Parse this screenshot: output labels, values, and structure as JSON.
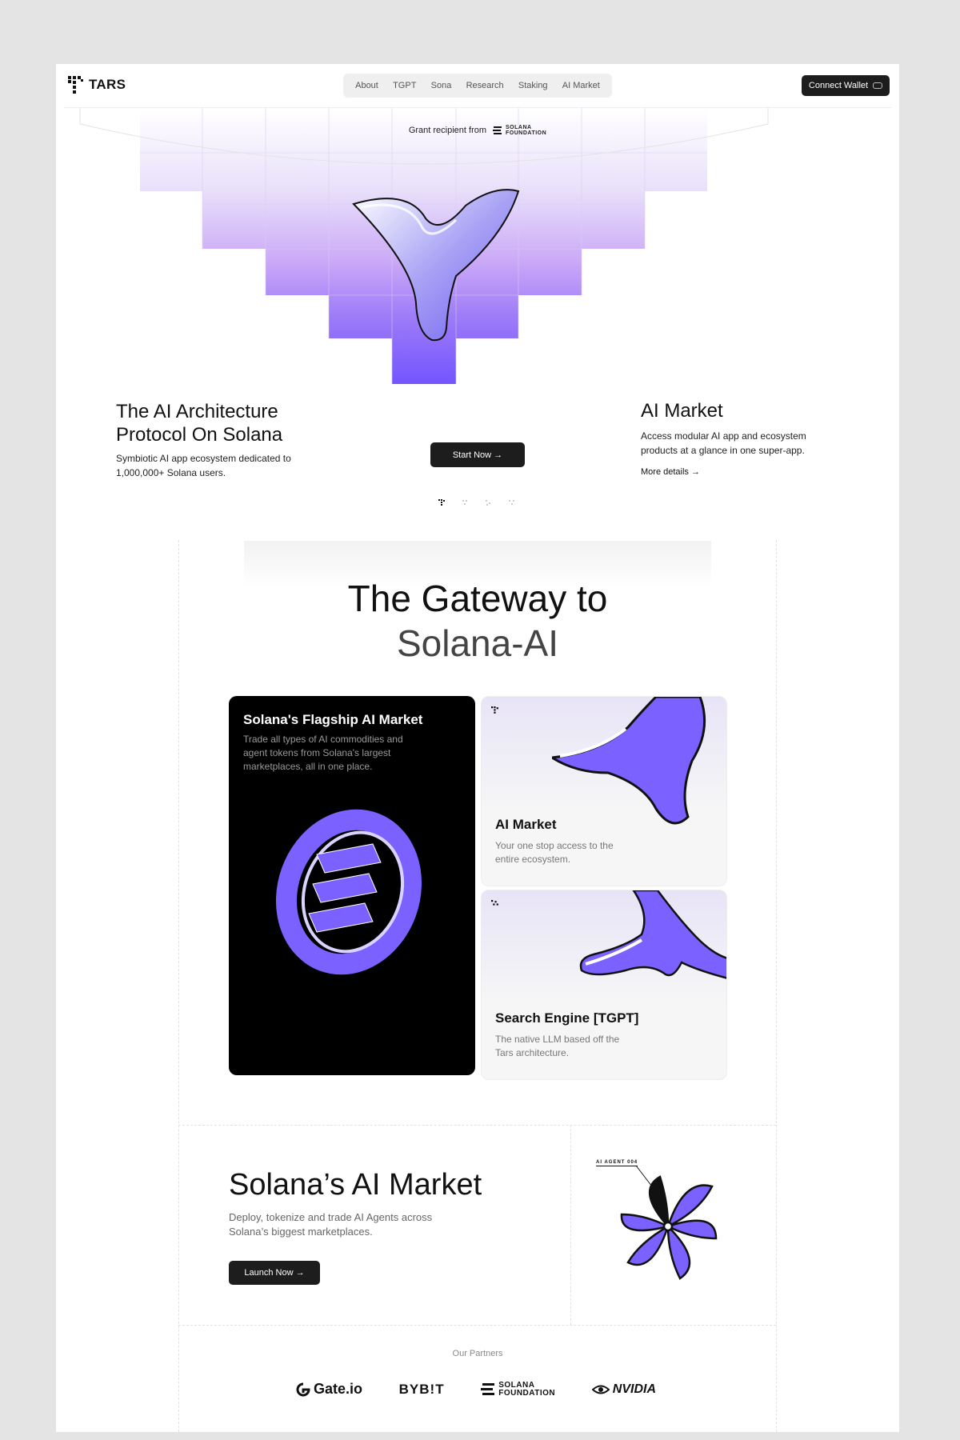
{
  "header": {
    "logo_text": "TARS",
    "nav": [
      "About",
      "TGPT",
      "Sona",
      "Research",
      "Staking",
      "AI Market"
    ],
    "connect_label": "Connect Wallet"
  },
  "hero": {
    "grant_text": "Grant recipient from",
    "grant_org_line1": "SOLANA",
    "grant_org_line2": "FOUNDATION",
    "title_line1": "The AI Architecture",
    "title_line2": "Protocol On Solana",
    "subtitle": "Symbiotic AI app ecosystem dedicated to 1,000,000+ Solana users.",
    "start_button": "Start Now →",
    "market_title": "AI Market",
    "market_subtitle": "Access modular AI app and ecosystem products at a glance in one super-app.",
    "more_details": "More details →"
  },
  "gateway": {
    "title_line1": "The Gateway to",
    "title_line2": "Solana-AI",
    "cards": [
      {
        "title": "Solana's Flagship AI Market",
        "text": "Trade all types of AI commodities and agent tokens from Solana's largest marketplaces, all in one place."
      },
      {
        "title": "AI Market",
        "text": "Your one stop access to the entire ecosystem."
      },
      {
        "title": "Search Engine [TGPT]",
        "text": "The native LLM based off the Tars architecture."
      }
    ]
  },
  "ai_market": {
    "title": "Solana’s AI Market",
    "subtitle": "Deploy, tokenize and trade AI Agents across Solana’s biggest marketplaces.",
    "launch_button": "Launch Now →",
    "agent_label": "AI AGENT 004"
  },
  "partners": {
    "label": "Our Partners",
    "items": [
      "Gate.io",
      "BYB!T",
      "SOLANA",
      "FOUNDATION",
      "NVIDIA"
    ]
  },
  "colors": {
    "accent": "#7b61ff",
    "dark_button": "#1d1d1d"
  }
}
